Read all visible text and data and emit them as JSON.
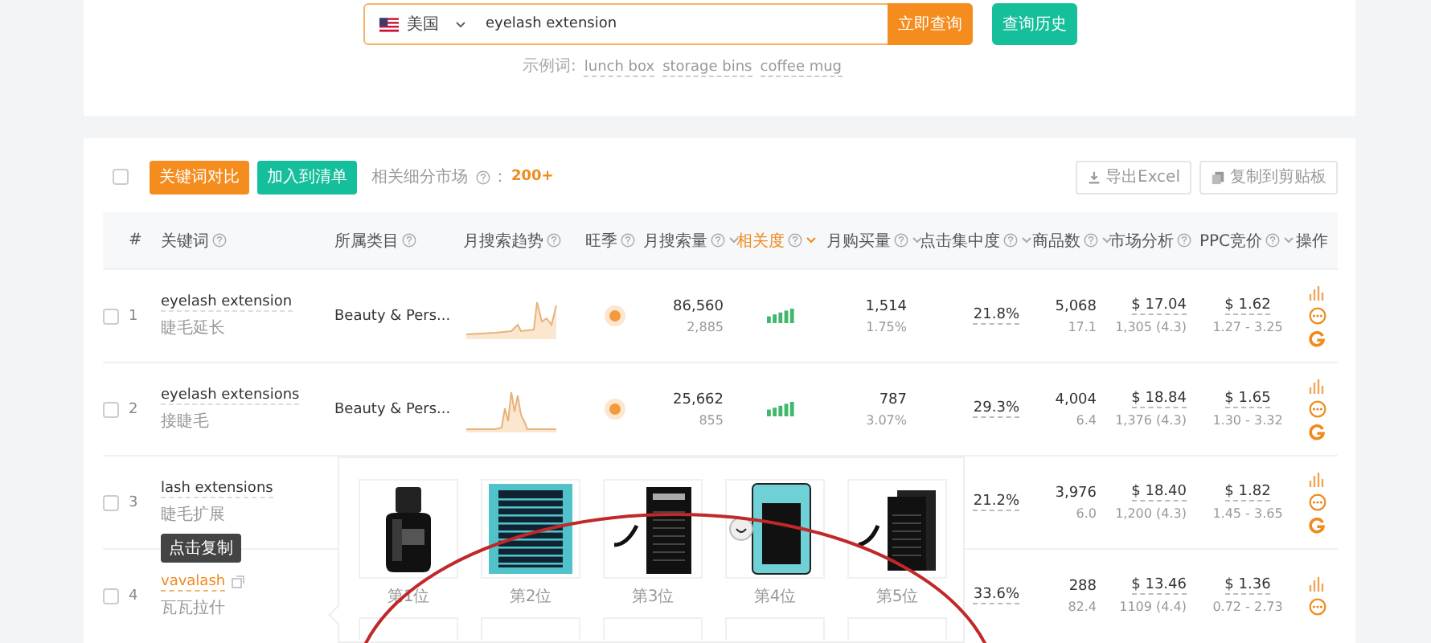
{
  "search": {
    "country": "美国",
    "value": "eyelash extension",
    "submit": "立即查询",
    "history": "查询历史",
    "examples_label": "示例词:",
    "examples": [
      "lunch box",
      "storage bins",
      "coffee mug"
    ]
  },
  "toolbar": {
    "select_all": {
      "checked": false
    },
    "compare": "关键词对比",
    "add_list": "加入到清单",
    "markets_label": "相关细分市场",
    "markets_sep": "：",
    "markets_count": "200+",
    "export": "导出Excel",
    "copy": "复制到剪贴板"
  },
  "table": {
    "columns": [
      {
        "label": "#",
        "help": false,
        "sort": false,
        "sorted": false
      },
      {
        "label": "关键词",
        "help": true,
        "sort": false,
        "sorted": false
      },
      {
        "label": "所属类目",
        "help": true,
        "sort": false,
        "sorted": false
      },
      {
        "label": "月搜索趋势",
        "help": true,
        "sort": false,
        "sorted": false
      },
      {
        "label": "旺季",
        "help": true,
        "sort": false,
        "sorted": false
      },
      {
        "label": "月搜索量",
        "help": true,
        "sort": true,
        "sorted": false
      },
      {
        "label": "相关度",
        "help": true,
        "sort": true,
        "sorted": true
      },
      {
        "label": "月购买量",
        "help": true,
        "sort": true,
        "sorted": false
      },
      {
        "label": "点击集中度",
        "help": true,
        "sort": true,
        "sorted": false
      },
      {
        "label": "商品数",
        "help": true,
        "sort": true,
        "sorted": false
      },
      {
        "label": "市场分析",
        "help": true,
        "sort": false,
        "sorted": false
      },
      {
        "label": "PPC竞价",
        "help": true,
        "sort": true,
        "sorted": false
      },
      {
        "label": "操作",
        "help": false,
        "sort": false,
        "sorted": false
      }
    ],
    "rows": [
      {
        "checked": false,
        "index": "1",
        "keyword": "eyelash extension",
        "translation": "睫毛延长",
        "hovered": false,
        "category": "Beauty & Pers...",
        "season": true,
        "volume": "86,560",
        "volume_sub": "2,885",
        "purchases": "1,514",
        "purchase_rate": "1.75%",
        "click_concentration": "21.8%",
        "products": "5,068",
        "product_ratio": "17.1",
        "price": "$ 17.04",
        "reviews": "1,305 (4.3)",
        "ppc": "$ 1.62",
        "ppc_range": "1.27 - 3.25"
      },
      {
        "checked": false,
        "index": "2",
        "keyword": "eyelash extensions",
        "translation": "接睫毛",
        "hovered": false,
        "category": "Beauty & Pers...",
        "season": true,
        "volume": "25,662",
        "volume_sub": "855",
        "purchases": "787",
        "purchase_rate": "3.07%",
        "click_concentration": "29.3%",
        "products": "4,004",
        "product_ratio": "6.4",
        "price": "$ 18.84",
        "reviews": "1,376 (4.3)",
        "ppc": "$ 1.65",
        "ppc_range": "1.30 - 3.32"
      },
      {
        "checked": false,
        "index": "3",
        "keyword": "lash extensions",
        "translation": "睫毛扩展",
        "hovered": false,
        "click_concentration": "21.2%",
        "products": "3,976",
        "product_ratio": "6.0",
        "price": "$ 18.40",
        "reviews": "1,200 (4.3)",
        "ppc": "$ 1.82",
        "ppc_range": "1.45 - 3.65"
      },
      {
        "checked": false,
        "index": "4",
        "keyword": "vavalash",
        "translation": "瓦瓦拉什",
        "hovered": true,
        "tooltip": "点击复制",
        "click_concentration": "33.6%",
        "products": "288",
        "product_ratio": "82.4",
        "price": "$ 13.46",
        "reviews": "1109 (4.4)",
        "ppc": "$ 1.36",
        "ppc_range": "0.72 - 2.73"
      }
    ]
  },
  "popup": {
    "items": [
      {
        "label": "第1位",
        "kind": "picture"
      },
      {
        "label": "第2位",
        "kind": "picture"
      },
      {
        "label": "第3位",
        "kind": "picture"
      },
      {
        "label": "第4位",
        "kind": "picture"
      },
      {
        "label": "第5位",
        "kind": "picture"
      }
    ]
  }
}
